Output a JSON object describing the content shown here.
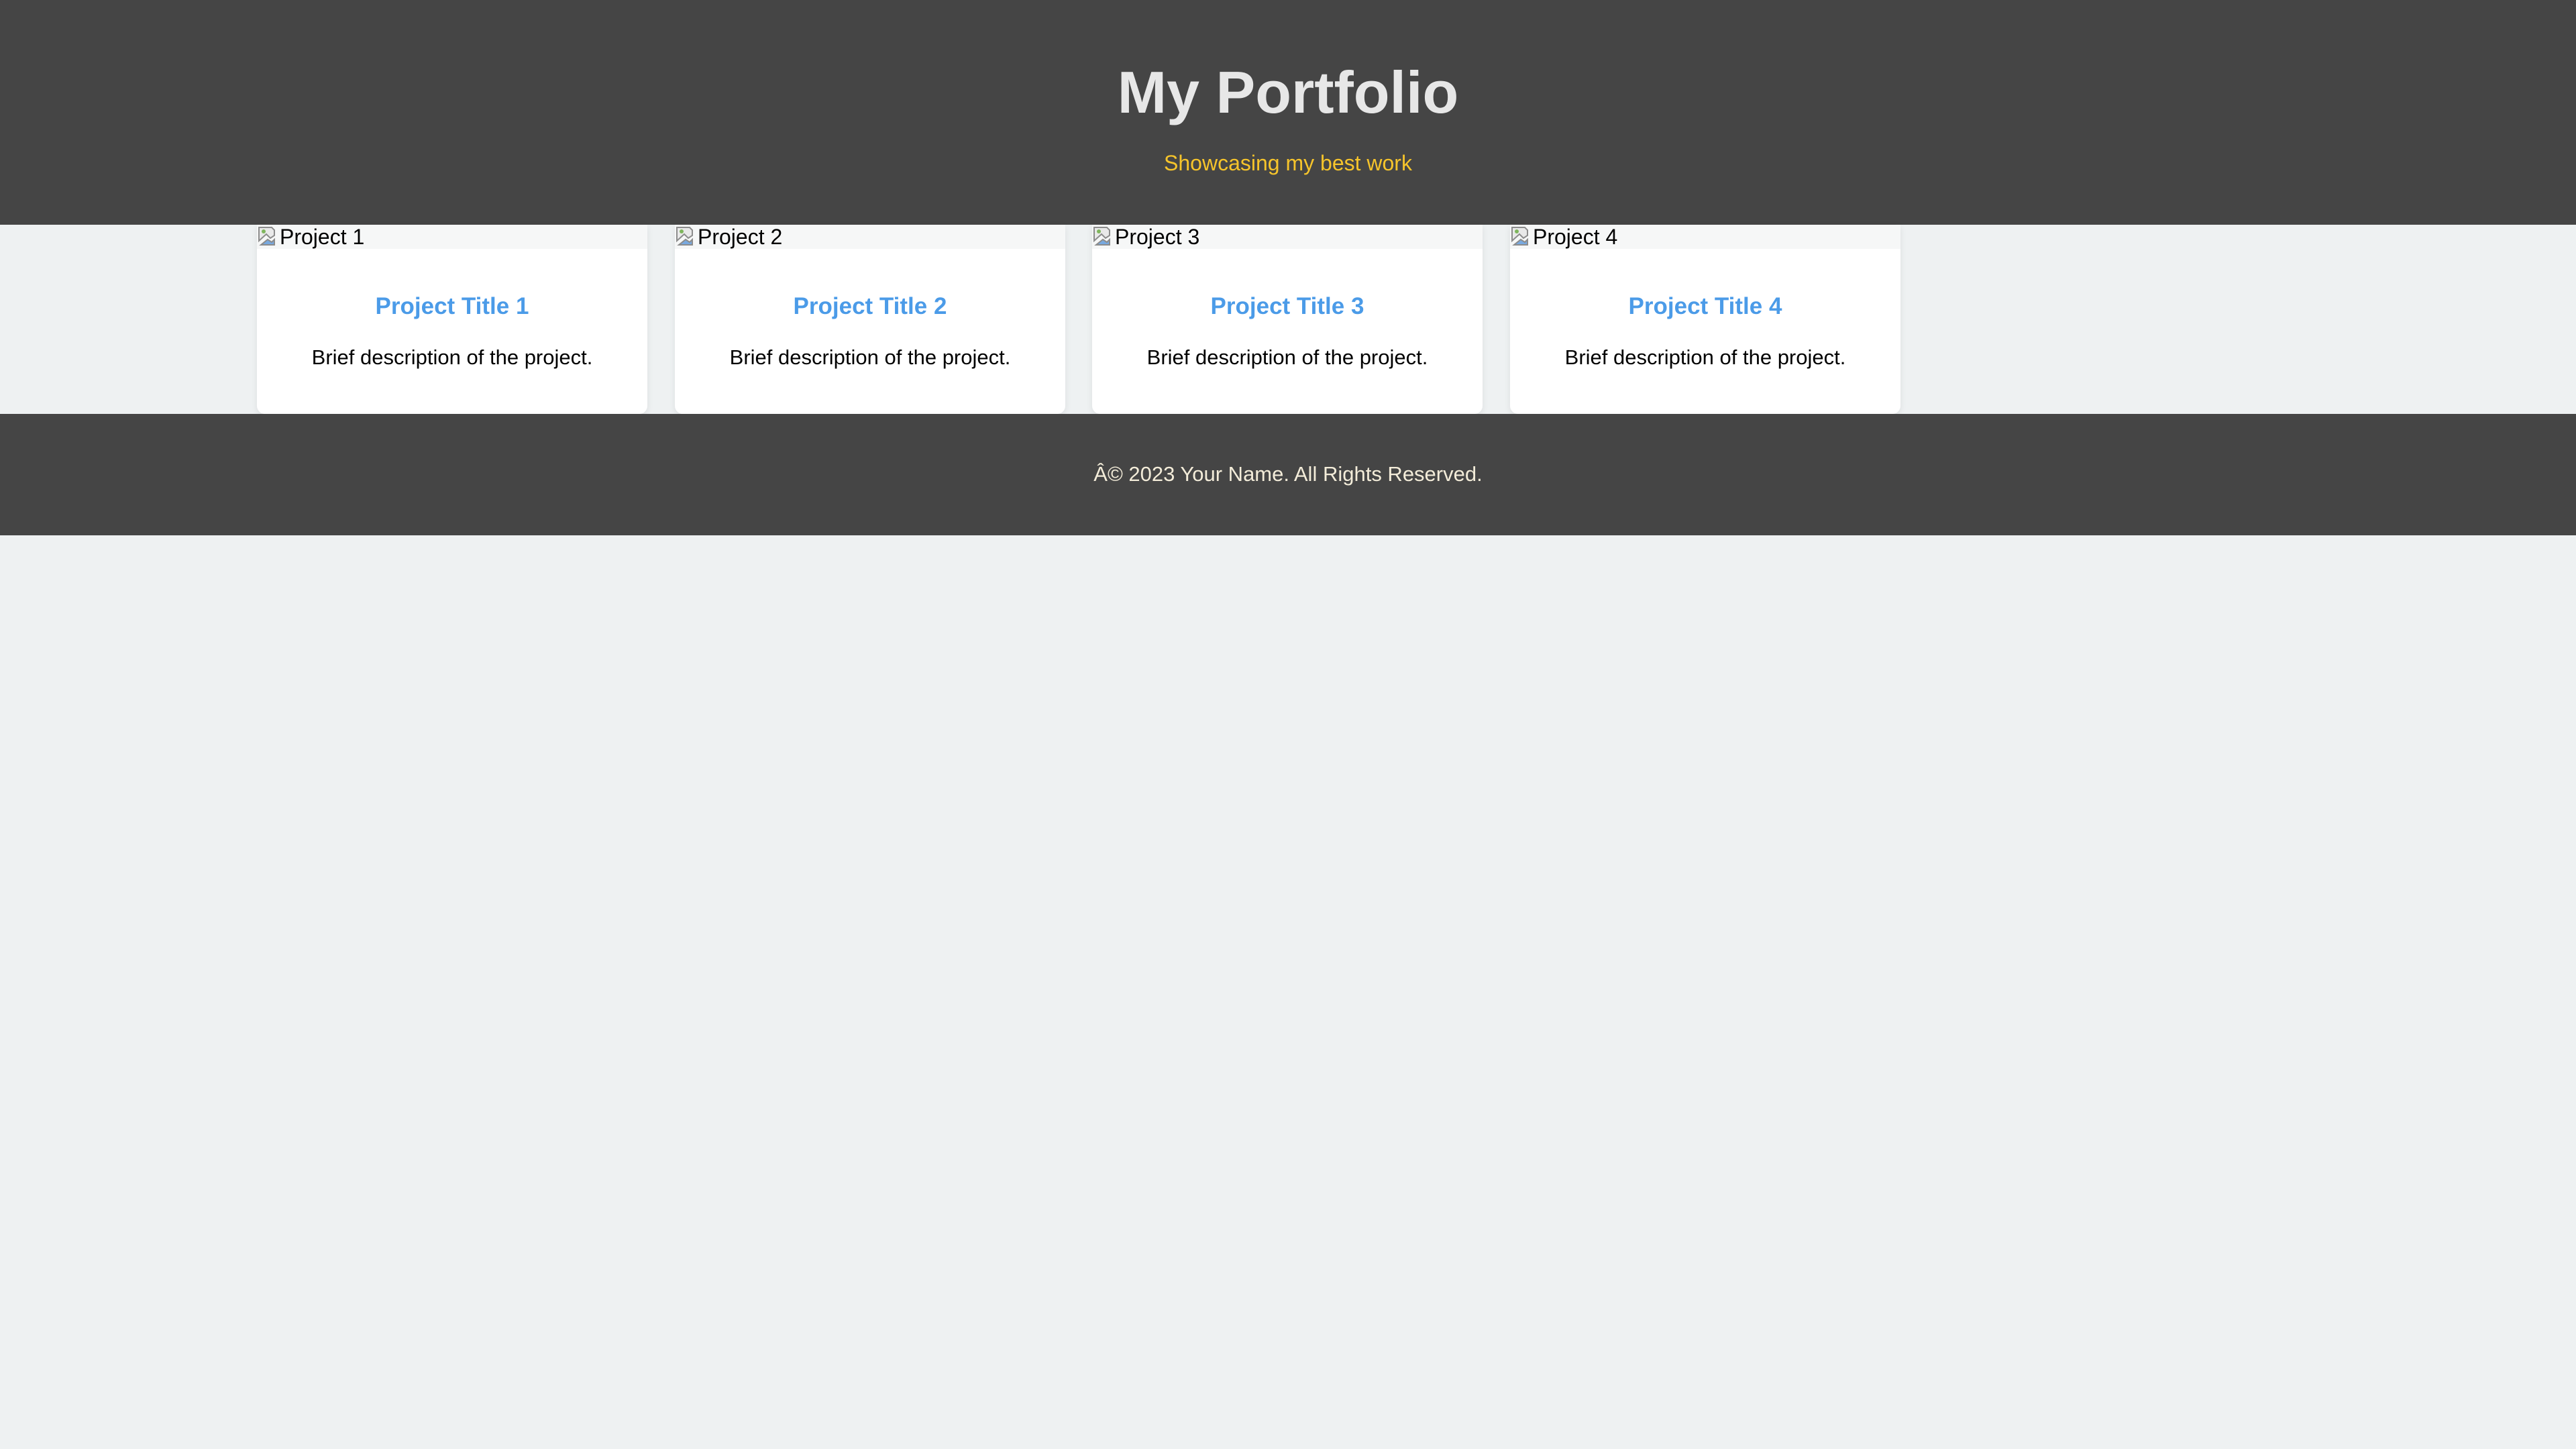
{
  "header": {
    "title": "My Portfolio",
    "tagline": "Showcasing my best work"
  },
  "projects": [
    {
      "image_alt": "Project 1",
      "title": "Project Title 1",
      "description": "Brief description of the project."
    },
    {
      "image_alt": "Project 2",
      "title": "Project Title 2",
      "description": "Brief description of the project."
    },
    {
      "image_alt": "Project 3",
      "title": "Project Title 3",
      "description": "Brief description of the project."
    },
    {
      "image_alt": "Project 4",
      "title": "Project Title 4",
      "description": "Brief description of the project."
    }
  ],
  "footer": {
    "copyright": "Â© 2023 Your Name. All Rights Reserved."
  },
  "colors": {
    "header_bg": "#454545",
    "title": "#e7e7e7",
    "tagline": "#f6c42b",
    "card_title": "#4b9be8",
    "page_bg": "#eef1f2",
    "footer_text": "#f3ecd9"
  },
  "icons": {
    "card_image": "broken-image-icon"
  }
}
